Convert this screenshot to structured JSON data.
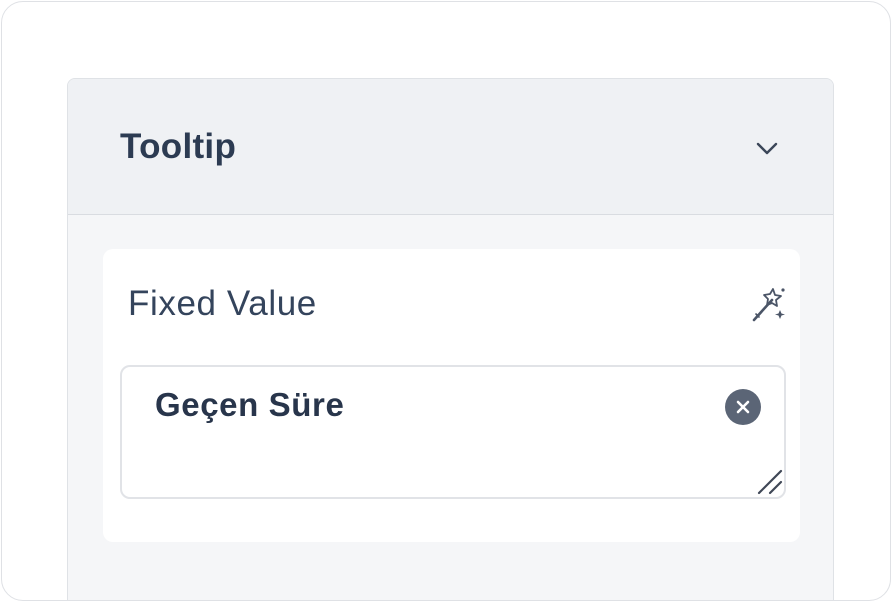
{
  "panel": {
    "title": "Tooltip",
    "collapse_icon": "chevron-down-icon"
  },
  "field": {
    "label": "Fixed Value",
    "action_icon": "magic-wand-icon",
    "value": "Geçen Süre",
    "clear_icon": "close-circle-icon",
    "resize_icon": "resize-handle-icon"
  },
  "colors": {
    "title_text": "#2c3b52",
    "label_text": "#34445c",
    "value_text": "#28354b",
    "header_bg": "#eff1f4",
    "panel_bg": "#f5f6f8",
    "card_bg": "#ffffff",
    "clear_button_bg": "#5b6576"
  }
}
